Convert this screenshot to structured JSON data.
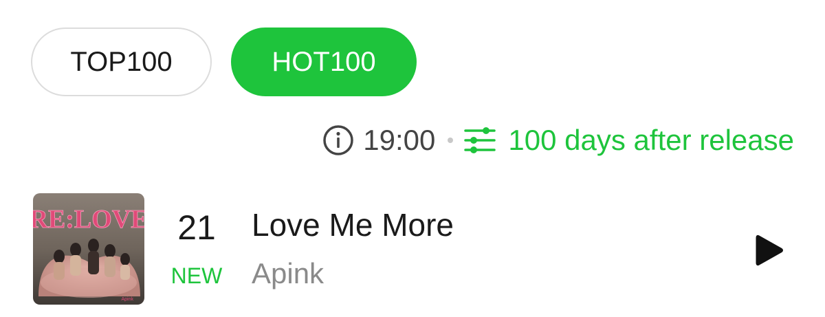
{
  "tabs": {
    "top100_label": "TOP100",
    "hot100_label": "HOT100",
    "active": "HOT100"
  },
  "info": {
    "time": "19:00",
    "filter_label": "100 days after release",
    "info_icon": "info-icon",
    "filter_icon": "sliders-icon"
  },
  "song": {
    "rank": "21",
    "rank_badge": "NEW",
    "title": "Love Me More",
    "artist": "Apink",
    "album_art_text": "RE:LOVE",
    "play_icon": "play-icon"
  },
  "colors": {
    "accent": "#1ec43c",
    "text_primary": "#1a1a1a",
    "text_secondary": "#8a8a8a"
  }
}
